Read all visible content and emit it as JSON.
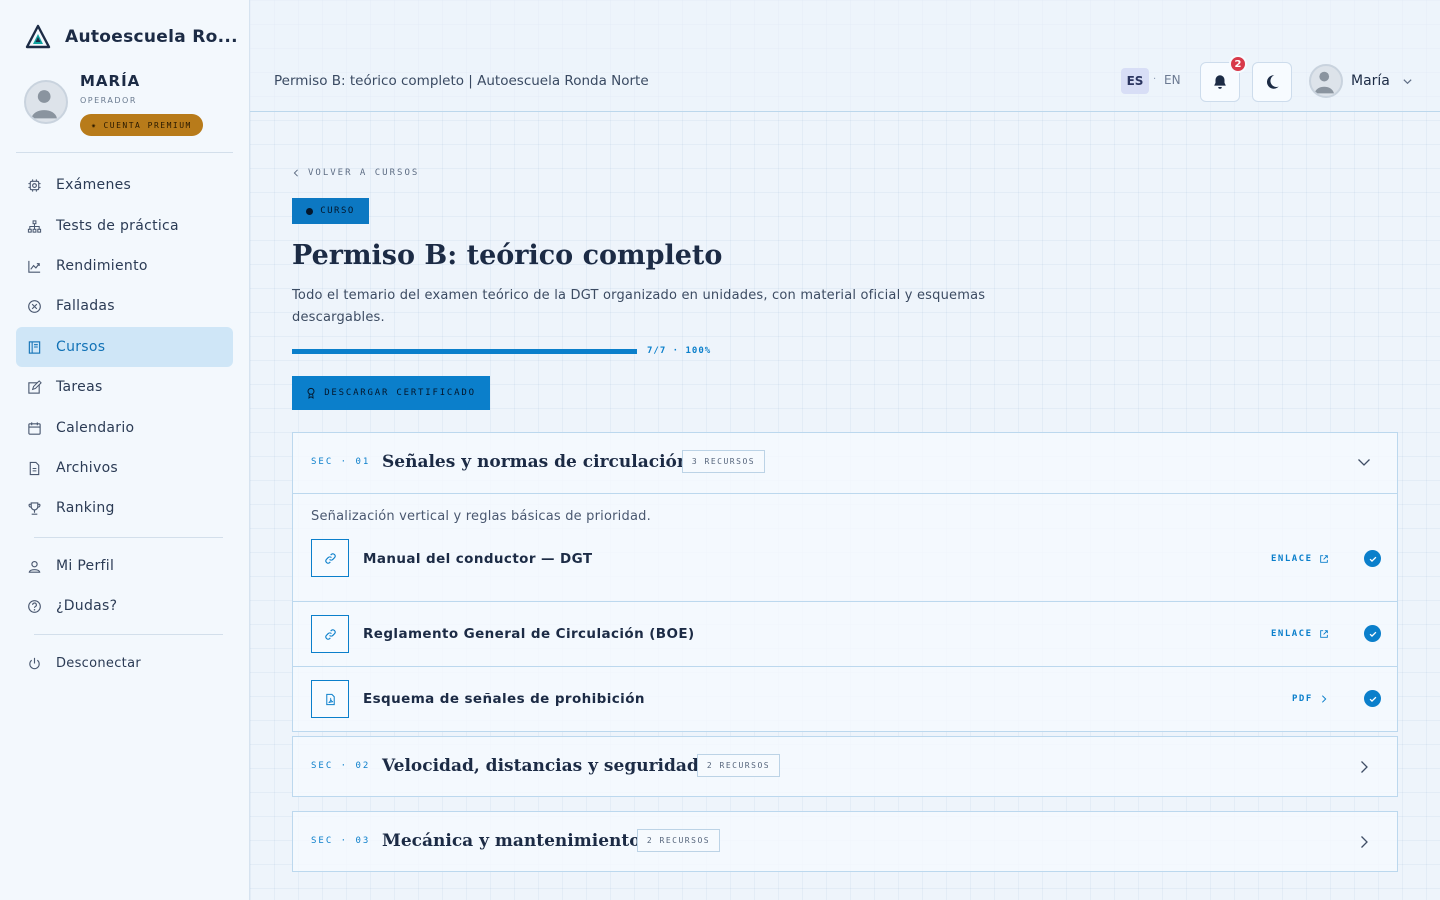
{
  "app": {
    "brand_name": "Autoescuela Ro...",
    "colors": {
      "accent": "#0b7fcb",
      "premium": "#b87b1a",
      "danger": "#d8394a",
      "text": "#1c2b45"
    }
  },
  "sidebar": {
    "user": {
      "name": "MARÍA",
      "role": "OPERADOR",
      "badge": "CUENTA PREMIUM"
    },
    "nav": [
      {
        "label": "Exámenes",
        "icon": "chip-icon"
      },
      {
        "label": "Tests de práctica",
        "icon": "hierarchy-icon"
      },
      {
        "label": "Rendimiento",
        "icon": "trend-chart-icon"
      },
      {
        "label": "Falladas",
        "icon": "x-circle-icon"
      },
      {
        "label": "Cursos",
        "icon": "book-icon",
        "active": true
      },
      {
        "label": "Tareas",
        "icon": "edit-icon"
      },
      {
        "label": "Calendario",
        "icon": "calendar-icon"
      },
      {
        "label": "Archivos",
        "icon": "file-icon"
      },
      {
        "label": "Ranking",
        "icon": "trophy-icon"
      }
    ],
    "secondary": [
      {
        "label": "Mi Perfil",
        "icon": "user-icon"
      },
      {
        "label": "¿Dudas?",
        "icon": "question-icon"
      }
    ],
    "logout": {
      "label": "Desconectar",
      "icon": "power-icon"
    }
  },
  "topbar": {
    "page_title": "Permiso B: teórico completo | Autoescuela Ronda Norte",
    "lang_active": "ES",
    "lang_sep": "·",
    "lang_other": "EN",
    "notifications_count": "2",
    "user_name": "María"
  },
  "course": {
    "back_label": "VOLVER A CURSOS",
    "tag": "CURSO",
    "title": "Permiso B: teórico completo",
    "description": "Todo el temario del examen teórico de la DGT organizado en unidades, con material oficial y esquemas descargables.",
    "progress": {
      "completed": 7,
      "total": 7,
      "percent": 100,
      "label": "7/7 · 100%"
    },
    "certificate_button": "DESCARGAR CERTIFICADO"
  },
  "sections": [
    {
      "number": "SEC · 01",
      "title": "Señales y normas de circulación",
      "count": "3 RECURSOS",
      "expanded": true,
      "summary": "Señalización vertical y reglas básicas de prioridad.",
      "resources": [
        {
          "title": "Manual del conductor — DGT",
          "type": "ENLACE",
          "icon": "link-icon",
          "done": true
        },
        {
          "title": "Reglamento General de Circulación (BOE)",
          "type": "ENLACE",
          "icon": "link-icon",
          "done": true
        },
        {
          "title": "Esquema de señales de prohibición",
          "type": "PDF",
          "icon": "pdf-icon",
          "done": true
        }
      ]
    },
    {
      "number": "SEC · 02",
      "title": "Velocidad, distancias y seguridad",
      "count": "2 RECURSOS",
      "expanded": false
    },
    {
      "number": "SEC · 03",
      "title": "Mecánica y mantenimiento",
      "count": "2 RECURSOS",
      "expanded": false
    }
  ]
}
